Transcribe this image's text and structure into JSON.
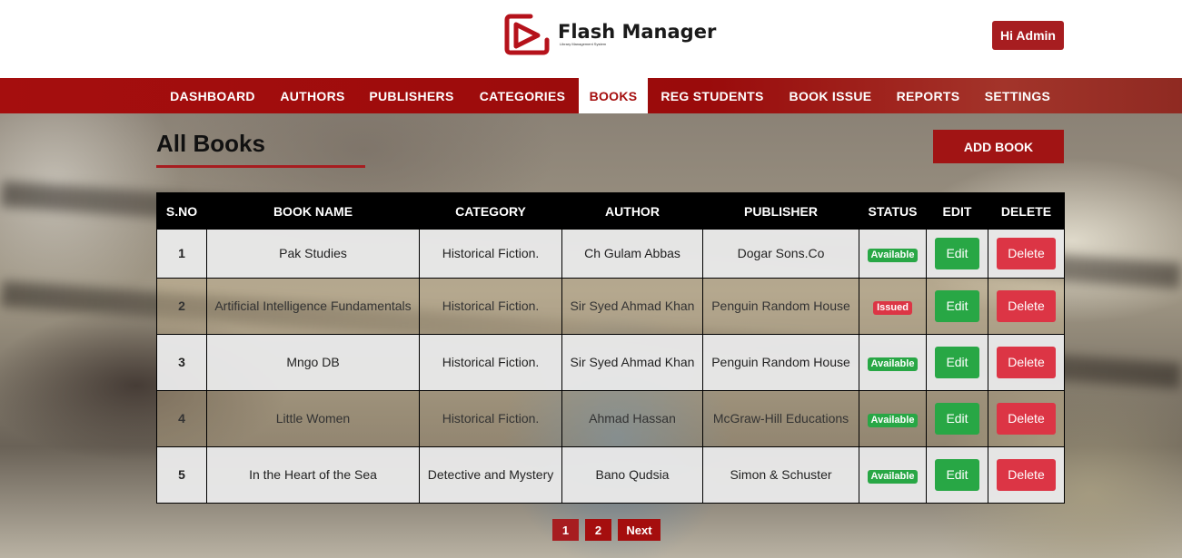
{
  "header": {
    "brand_title": "Flash Manager",
    "brand_subtitle": "Library Management System",
    "user_button": "Hi Admin"
  },
  "nav": {
    "items": [
      {
        "label": "DASHBOARD"
      },
      {
        "label": "AUTHORS"
      },
      {
        "label": "PUBLISHERS"
      },
      {
        "label": "CATEGORIES"
      },
      {
        "label": "BOOKS",
        "active": true
      },
      {
        "label": "REG STUDENTS"
      },
      {
        "label": "BOOK ISSUE"
      },
      {
        "label": "REPORTS"
      },
      {
        "label": "SETTINGS"
      }
    ]
  },
  "page": {
    "title": "All Books",
    "add_button": "ADD BOOK"
  },
  "table": {
    "columns": [
      "S.NO",
      "BOOK NAME",
      "CATEGORY",
      "AUTHOR",
      "PUBLISHER",
      "STATUS",
      "EDIT",
      "DELETE"
    ],
    "rows": [
      {
        "sno": "1",
        "name": "Pak Studies",
        "category": "Historical Fiction.",
        "author": "Ch Gulam Abbas",
        "publisher": "Dogar Sons.Co",
        "status": "Available",
        "edit": "Edit",
        "delete": "Delete"
      },
      {
        "sno": "2",
        "name": "Artificial Intelligence Fundamentals",
        "category": "Historical Fiction.",
        "author": "Sir Syed Ahmad Khan",
        "publisher": "Penguin Random House",
        "status": "Issued",
        "edit": "Edit",
        "delete": "Delete"
      },
      {
        "sno": "3",
        "name": "Mngo DB",
        "category": "Historical Fiction.",
        "author": "Sir Syed Ahmad Khan",
        "publisher": "Penguin Random House",
        "status": "Available",
        "edit": "Edit",
        "delete": "Delete"
      },
      {
        "sno": "4",
        "name": "Little Women",
        "category": "Historical Fiction.",
        "author": "Ahmad Hassan",
        "publisher": "McGraw-Hill Educations",
        "status": "Available",
        "edit": "Edit",
        "delete": "Delete"
      },
      {
        "sno": "5",
        "name": "In the Heart of the Sea",
        "category": "Detective and Mystery",
        "author": "Bano Qudsia",
        "publisher": "Simon & Schuster",
        "status": "Available",
        "edit": "Edit",
        "delete": "Delete"
      }
    ]
  },
  "pagination": {
    "pages": [
      "1",
      "2"
    ],
    "next": "Next"
  },
  "colors": {
    "brand_red": "#a50e0e",
    "available": "#28a745",
    "issued": "#dc3545"
  }
}
